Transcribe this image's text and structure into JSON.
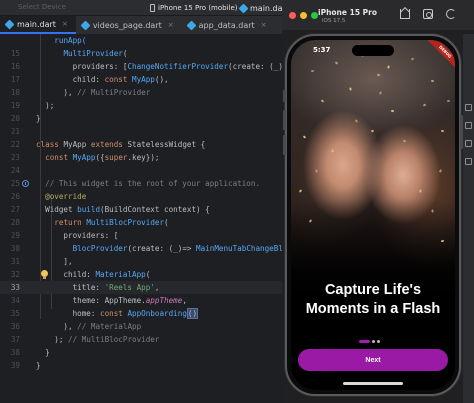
{
  "ide": {
    "top_left_faded": "Select Device",
    "device_selector": "iPhone 15 Pro (mobile)",
    "active_file": "main.dart",
    "tabs": [
      {
        "label": "main.dart",
        "active": true
      },
      {
        "label": "videos_page.dart",
        "active": false
      },
      {
        "label": "app_data.dart",
        "active": false
      }
    ]
  },
  "editor": {
    "current_line": "33",
    "lines": [
      {
        "n": "",
        "parts": [
          {
            "t": "    ",
            "c": "id"
          },
          {
            "t": "runApp(",
            "c": "fn"
          }
        ]
      },
      {
        "n": "15",
        "parts": [
          {
            "t": "      ",
            "c": "id"
          },
          {
            "t": "MultiProvider",
            "c": "fn"
          },
          {
            "t": "(",
            "c": "par"
          }
        ]
      },
      {
        "n": "16",
        "parts": [
          {
            "t": "        providers: [",
            "c": "id"
          },
          {
            "t": "ChangeNotifierProvider",
            "c": "fn"
          },
          {
            "t": "(create: (_)=> ",
            "c": "id"
          },
          {
            "t": "SizeProv",
            "c": "fn"
          }
        ]
      },
      {
        "n": "17",
        "parts": [
          {
            "t": "        child: ",
            "c": "id"
          },
          {
            "t": "const ",
            "c": "kw"
          },
          {
            "t": "MyApp",
            "c": "fn"
          },
          {
            "t": "(),",
            "c": "id"
          }
        ]
      },
      {
        "n": "18",
        "parts": [
          {
            "t": "      ), ",
            "c": "id"
          },
          {
            "t": "// MultiProvider",
            "c": "cm"
          }
        ]
      },
      {
        "n": "19",
        "parts": [
          {
            "t": "  );",
            "c": "id"
          }
        ]
      },
      {
        "n": "20",
        "parts": [
          {
            "t": "}",
            "c": "id"
          }
        ]
      },
      {
        "n": "21",
        "parts": []
      },
      {
        "n": "22",
        "parts": [
          {
            "t": "class ",
            "c": "kw"
          },
          {
            "t": "MyApp ",
            "c": "id"
          },
          {
            "t": "extends ",
            "c": "kw"
          },
          {
            "t": "StatelessWidget {",
            "c": "id"
          }
        ]
      },
      {
        "n": "23",
        "parts": [
          {
            "t": "  ",
            "c": "id"
          },
          {
            "t": "const ",
            "c": "kw"
          },
          {
            "t": "MyApp",
            "c": "fn"
          },
          {
            "t": "({",
            "c": "id"
          },
          {
            "t": "super",
            "c": "kw"
          },
          {
            "t": ".key});",
            "c": "id"
          }
        ]
      },
      {
        "n": "24",
        "parts": []
      },
      {
        "n": "25",
        "parts": [
          {
            "t": "  // This widget is the root of your application.",
            "c": "cm"
          }
        ]
      },
      {
        "n": "26",
        "parts": [
          {
            "t": "  @override",
            "c": "ann"
          }
        ]
      },
      {
        "n": "27",
        "parts": [
          {
            "t": "  Widget ",
            "c": "id"
          },
          {
            "t": "build",
            "c": "fn"
          },
          {
            "t": "(BuildContext context) {",
            "c": "id"
          }
        ]
      },
      {
        "n": "28",
        "parts": [
          {
            "t": "    ",
            "c": "id"
          },
          {
            "t": "return ",
            "c": "kw"
          },
          {
            "t": "MultiBlocProvider",
            "c": "fn"
          },
          {
            "t": "(",
            "c": "par"
          }
        ]
      },
      {
        "n": "29",
        "parts": [
          {
            "t": "      providers: [",
            "c": "id"
          }
        ]
      },
      {
        "n": "30",
        "parts": [
          {
            "t": "        ",
            "c": "id"
          },
          {
            "t": "BlocProvider",
            "c": "fn"
          },
          {
            "t": "(create: (_)=> ",
            "c": "id"
          },
          {
            "t": "MainMenuTabChangeBloc",
            "c": "fn"
          },
          {
            "t": "())",
            "c": "id"
          }
        ]
      },
      {
        "n": "31",
        "parts": [
          {
            "t": "      ],",
            "c": "id"
          }
        ]
      },
      {
        "n": "32",
        "parts": [
          {
            "t": "      child: ",
            "c": "id"
          },
          {
            "t": "MaterialApp",
            "c": "fn"
          },
          {
            "t": "(",
            "c": "par"
          }
        ]
      },
      {
        "n": "33",
        "parts": [
          {
            "t": "        title: ",
            "c": "id"
          },
          {
            "t": "'Reels App'",
            "c": "str"
          },
          {
            "t": ",",
            "c": "id"
          }
        ]
      },
      {
        "n": "34",
        "parts": [
          {
            "t": "        theme: AppTheme.",
            "c": "id"
          },
          {
            "t": "appTheme",
            "c": "ital"
          },
          {
            "t": ",",
            "c": "id"
          }
        ]
      },
      {
        "n": "35",
        "parts": [
          {
            "t": "        home: ",
            "c": "id"
          },
          {
            "t": "const ",
            "c": "kw"
          },
          {
            "t": "AppOnboarding",
            "c": "fn"
          },
          {
            "t": "()",
            "c": "hl"
          }
        ]
      },
      {
        "n": "36",
        "parts": [
          {
            "t": "      ), ",
            "c": "id"
          },
          {
            "t": "// MaterialApp",
            "c": "cm"
          }
        ]
      },
      {
        "n": "37",
        "parts": [
          {
            "t": "    ); ",
            "c": "id"
          },
          {
            "t": "// MultiBlocProvider",
            "c": "cm"
          }
        ]
      },
      {
        "n": "38",
        "parts": [
          {
            "t": "  }",
            "c": "id"
          }
        ]
      },
      {
        "n": "39",
        "parts": [
          {
            "t": "}",
            "c": "id"
          }
        ]
      }
    ]
  },
  "simulator": {
    "device_name": "iPhone 15 Pro",
    "os_version": "iOS 17.5",
    "status_time": "5:37",
    "debug_banner": "DEBUG",
    "headline_line1": "Capture Life's",
    "headline_line2": "Moments in a Flash",
    "page_count": 3,
    "active_page": 0,
    "next_label": "Next"
  }
}
